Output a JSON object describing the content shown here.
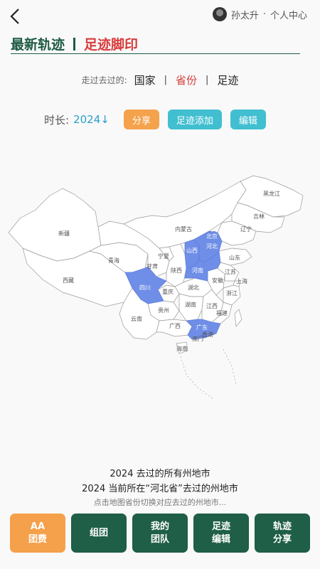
{
  "header": {
    "back_icon": "chevron-left-icon",
    "user_name": "孙太升",
    "separator": "·",
    "user_center": "个人中心"
  },
  "title": {
    "primary": "最新轨迹",
    "secondary": "足迹脚印"
  },
  "filter": {
    "label": "走过去过的:",
    "options": [
      {
        "label": "国家",
        "active": false
      },
      {
        "label": "省份",
        "active": true
      },
      {
        "label": "足迹",
        "active": false
      }
    ],
    "divider": "|"
  },
  "controls": {
    "duration_label": "时长:",
    "year": "2024↓",
    "share": "分享",
    "add_footprint": "足迹添加",
    "edit": "编辑"
  },
  "map": {
    "highlight_color": "#6f8ee8",
    "provinces": [
      {
        "name": "新疆",
        "visited": false
      },
      {
        "name": "西藏",
        "visited": false
      },
      {
        "name": "青海",
        "visited": false
      },
      {
        "name": "甘肃",
        "visited": false
      },
      {
        "name": "内蒙古",
        "visited": false
      },
      {
        "name": "黑龙江",
        "visited": false
      },
      {
        "name": "吉林",
        "visited": false
      },
      {
        "name": "辽宁",
        "visited": false
      },
      {
        "name": "北京",
        "visited": true
      },
      {
        "name": "河北",
        "visited": true
      },
      {
        "name": "山西",
        "visited": true
      },
      {
        "name": "河南",
        "visited": true
      },
      {
        "name": "山东",
        "visited": false
      },
      {
        "name": "宁夏",
        "visited": false
      },
      {
        "name": "陕西",
        "visited": false
      },
      {
        "name": "四川",
        "visited": true
      },
      {
        "name": "重庆",
        "visited": false
      },
      {
        "name": "湖北",
        "visited": false
      },
      {
        "name": "安徽",
        "visited": false
      },
      {
        "name": "江苏",
        "visited": false
      },
      {
        "name": "上海",
        "visited": false
      },
      {
        "name": "浙江",
        "visited": false
      },
      {
        "name": "贵州",
        "visited": false
      },
      {
        "name": "湖南",
        "visited": false
      },
      {
        "name": "江西",
        "visited": false
      },
      {
        "name": "福建",
        "visited": false
      },
      {
        "name": "云南",
        "visited": false
      },
      {
        "name": "广西",
        "visited": false
      },
      {
        "name": "广东",
        "visited": true
      },
      {
        "name": "香港",
        "visited": false
      },
      {
        "name": "澳门",
        "visited": false
      },
      {
        "name": "海南",
        "visited": false
      }
    ]
  },
  "captions": {
    "line1": "2024 去过的所有州地市",
    "line2": "2024 当前所在“河北省”去过的州地市",
    "hint": "点击地图省份切换对应去过的州地市..."
  },
  "footer": {
    "buttons": [
      {
        "label": "AA\n团费",
        "style": "orange"
      },
      {
        "label": "组团",
        "style": "green"
      },
      {
        "label": "我的\n团队",
        "style": "green"
      },
      {
        "label": "足迹\n编辑",
        "style": "green"
      },
      {
        "label": "轨迹\n分享",
        "style": "green"
      }
    ]
  }
}
